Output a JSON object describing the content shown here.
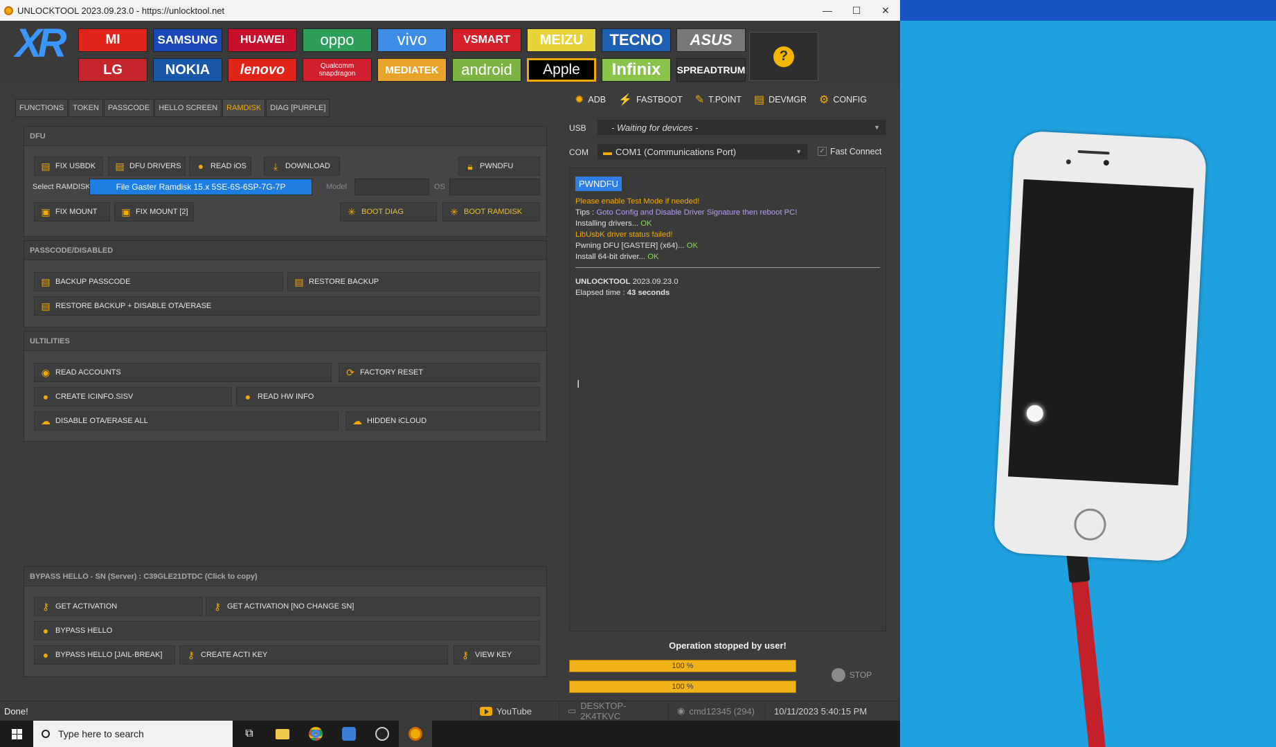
{
  "window": {
    "title": "UNLOCKTOOL 2023.09.23.0 - https://unlocktool.net",
    "controls": [
      "—",
      "☐",
      "✕"
    ]
  },
  "brands": {
    "row1": [
      "MI",
      "SAMSUNG",
      "HUAWEI",
      "oppo",
      "vivo",
      "VSMART",
      "MEIZU",
      "TECNO",
      "ASUS"
    ],
    "row2": [
      "LG",
      "NOKIA",
      "lenovo",
      "Qualcomm snapdragon",
      "MEDIATEK",
      "android",
      "Apple",
      "Infinix",
      "SPREADTRUM"
    ],
    "logo": "XR",
    "help": "?"
  },
  "tabs": [
    "FUNCTIONS",
    "TOKEN",
    "PASSCODE",
    "HELLO SCREEN",
    "RAMDISK",
    "DIAG [PURPLE]"
  ],
  "dfu": {
    "header": "DFU",
    "fix_usbdk": "FIX USBDK",
    "dfu_drivers": "DFU DRIVERS",
    "read_ios": "READ iOS",
    "download": "DOWNLOAD",
    "pwndfu": "PWNDFU",
    "select_ramdisk_label": "Select RAMDISK",
    "ramdisk_value": "File Gaster Ramdisk 15.x 5SE-6S-6SP-7G-7P",
    "model_label": "Model",
    "os_label": "OS",
    "fix_mount": "FIX MOUNT",
    "fix_mount2": "FIX MOUNT [2]",
    "boot_diag": "BOOT DIAG",
    "boot_ramdisk": "BOOT RAMDISK"
  },
  "passcode": {
    "header": "PASSCODE/DISABLED",
    "backup": "BACKUP PASSCODE",
    "restore": "RESTORE BACKUP",
    "restore_disable": "RESTORE BACKUP + DISABLE OTA/ERASE"
  },
  "utilities": {
    "header": "ULTILITIES",
    "read_accounts": "READ ACCOUNTS",
    "factory_reset": "FACTORY RESET",
    "create_icinfo": "CREATE ICINFO.SISV",
    "read_hw": "READ HW INFO",
    "disable_ota": "DISABLE OTA/ERASE ALL",
    "hidden_icloud": "HIDDEN iCLOUD"
  },
  "bypass": {
    "header": "BYPASS HELLO - SN (Server) : C39GLE21DTDC (Click to copy)",
    "get_activation": "GET ACTIVATION",
    "get_activation_nochange": "GET ACTIVATION [NO CHANGE SN]",
    "bypass_hello": "BYPASS HELLO",
    "bypass_jailbreak": "BYPASS HELLO [JAIL-BREAK]",
    "create_acti": "CREATE ACTI KEY",
    "view_key": "VIEW KEY"
  },
  "toolbar": [
    "ADB",
    "FASTBOOT",
    "T.POINT",
    "DEVMGR",
    "CONFIG"
  ],
  "connection": {
    "usb_label": "USB",
    "usb_value": "- Waiting for devices -",
    "com_label": "COM",
    "com_value": "COM1 (Communications Port)",
    "fast_connect": "Fast Connect",
    "fast_connect_checked": true
  },
  "log": {
    "badge": "PWNDFU",
    "l1": "Please enable Test Mode if needed!",
    "l2a": "Tips : ",
    "l2b": "Goto Config and Disable Driver Signature then reboot PC!",
    "l3a": "Installing drivers... ",
    "ok": "OK",
    "l4": "LibUsbK driver status failed!",
    "l5a": "Pwning ",
    "l5b": "DFU [GASTER] (x64)... ",
    "l6a": "Install 64-bit driver... ",
    "l7a": "UNLOCKTOOL",
    "l7b": " 2023.09.23.0",
    "l8a": "Elapsed time : ",
    "l8b": "43 seconds"
  },
  "progress": {
    "message": "Operation stopped by user!",
    "bar1": "100 %",
    "bar2": "100 %",
    "bar1_fraction": 1.0,
    "bar2_fraction": 1.0,
    "stop": "STOP"
  },
  "status": {
    "text": "Done!",
    "youtube": "YouTube",
    "pc": "DESKTOP-2K4TKVC",
    "user": "cmd12345 (294)",
    "datetime": "10/11/2023 5:40:15 PM"
  },
  "taskbar": {
    "search_placeholder": "Type here to search"
  },
  "colors": {
    "accent": "#f2a900",
    "select_blue": "#1d7de0",
    "ok_green": "#7ee04c",
    "tip_purple": "#b59ef0"
  }
}
